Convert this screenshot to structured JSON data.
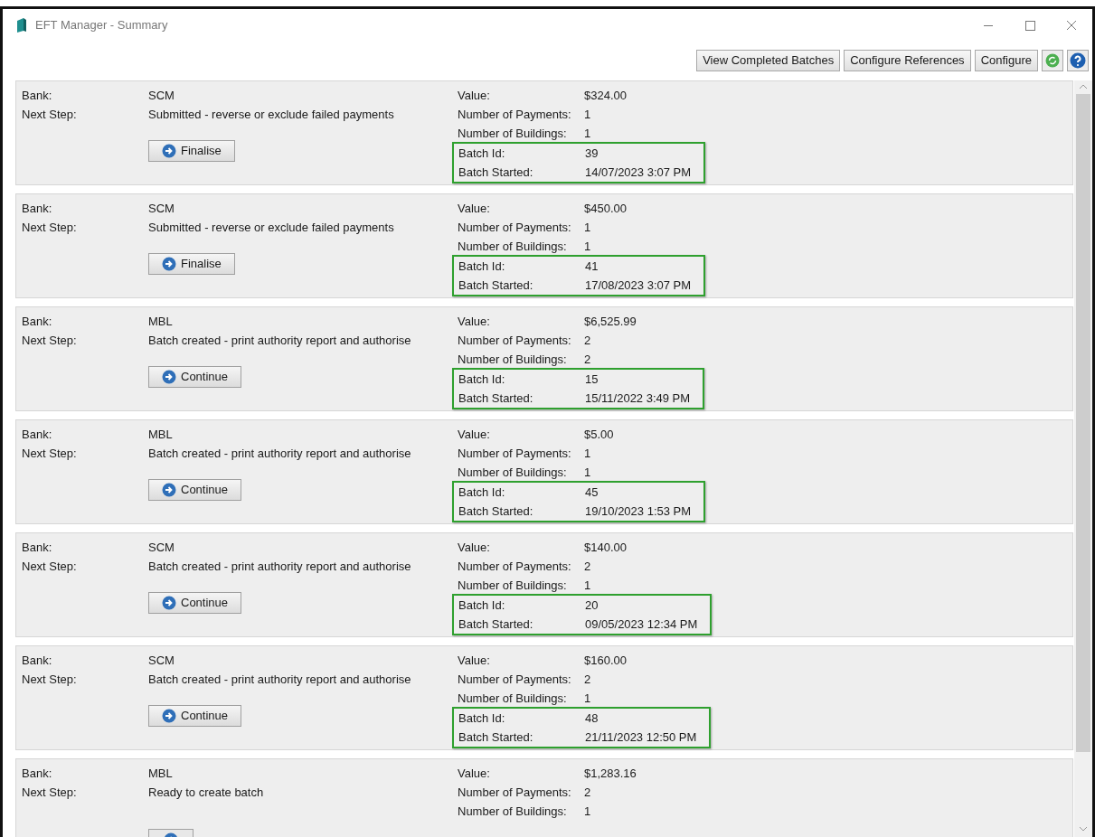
{
  "window": {
    "title": "EFT Manager - Summary"
  },
  "toolbar": {
    "buttons": [
      "View Completed Batches",
      "Configure References",
      "Configure"
    ]
  },
  "batches": [
    {
      "left": [
        {
          "label": "Bank:",
          "value": "SCM"
        },
        {
          "label": "Next Step:",
          "value": "Submitted - reverse or exclude failed payments"
        }
      ],
      "action": "Finalise",
      "details": [
        {
          "label": "Value:",
          "value": "$324.00"
        },
        {
          "label": "Number of Payments:",
          "value": "1"
        },
        {
          "label": "Number of Buildings:",
          "value": "1"
        }
      ],
      "highlighted": [
        {
          "label": "Batch Id:",
          "value": "39"
        },
        {
          "label": "Batch Started:",
          "value": "14/07/2023 3:07 PM"
        }
      ]
    },
    {
      "left": [
        {
          "label": "Bank:",
          "value": "SCM"
        },
        {
          "label": "Next Step:",
          "value": "Submitted - reverse or exclude failed payments"
        }
      ],
      "action": "Finalise",
      "details": [
        {
          "label": "Value:",
          "value": "$450.00"
        },
        {
          "label": "Number of Payments:",
          "value": "1"
        },
        {
          "label": "Number of Buildings:",
          "value": "1"
        }
      ],
      "highlighted": [
        {
          "label": "Batch Id:",
          "value": "41"
        },
        {
          "label": "Batch Started:",
          "value": "17/08/2023 3:07 PM"
        }
      ]
    },
    {
      "left": [
        {
          "label": "Bank:",
          "value": "MBL"
        },
        {
          "label": "Next Step:",
          "value": "Batch created - print authority report and authorise"
        }
      ],
      "action": "Continue",
      "details": [
        {
          "label": "Value:",
          "value": "$6,525.99"
        },
        {
          "label": "Number of Payments:",
          "value": "2"
        },
        {
          "label": "Number of Buildings:",
          "value": "2"
        }
      ],
      "highlighted": [
        {
          "label": "Batch Id:",
          "value": "15"
        },
        {
          "label": "Batch Started:",
          "value": "15/11/2022 3:49 PM"
        }
      ]
    },
    {
      "left": [
        {
          "label": "Bank:",
          "value": "MBL"
        },
        {
          "label": "Next Step:",
          "value": "Batch created - print authority report and authorise"
        }
      ],
      "action": "Continue",
      "details": [
        {
          "label": "Value:",
          "value": "$5.00"
        },
        {
          "label": "Number of Payments:",
          "value": "1"
        },
        {
          "label": "Number of Buildings:",
          "value": "1"
        }
      ],
      "highlighted": [
        {
          "label": "Batch Id:",
          "value": "45"
        },
        {
          "label": "Batch Started:",
          "value": "19/10/2023 1:53 PM"
        }
      ]
    },
    {
      "left": [
        {
          "label": "Bank:",
          "value": "SCM"
        },
        {
          "label": "Next Step:",
          "value": "Batch created - print authority report and authorise"
        }
      ],
      "action": "Continue",
      "details": [
        {
          "label": "Value:",
          "value": "$140.00"
        },
        {
          "label": "Number of Payments:",
          "value": "2"
        },
        {
          "label": "Number of Buildings:",
          "value": "1"
        }
      ],
      "highlighted": [
        {
          "label": "Batch Id:",
          "value": "20"
        },
        {
          "label": "Batch Started:",
          "value": "09/05/2023 12:34 PM"
        }
      ]
    },
    {
      "left": [
        {
          "label": "Bank:",
          "value": "SCM"
        },
        {
          "label": "Next Step:",
          "value": "Batch created - print authority report and authorise"
        }
      ],
      "action": "Continue",
      "details": [
        {
          "label": "Value:",
          "value": "$160.00"
        },
        {
          "label": "Number of Payments:",
          "value": "2"
        },
        {
          "label": "Number of Buildings:",
          "value": "1"
        }
      ],
      "highlighted": [
        {
          "label": "Batch Id:",
          "value": "48"
        },
        {
          "label": "Batch Started:",
          "value": "21/11/2023 12:50 PM"
        }
      ]
    },
    {
      "left": [
        {
          "label": "Bank:",
          "value": "MBL"
        },
        {
          "label": "Next Step:",
          "value": "Ready to create batch"
        }
      ],
      "details": [
        {
          "label": "Value:",
          "value": "$1,283.16"
        },
        {
          "label": "Number of Payments:",
          "value": "2"
        },
        {
          "label": "Number of Buildings:",
          "value": "1"
        }
      ]
    }
  ]
}
